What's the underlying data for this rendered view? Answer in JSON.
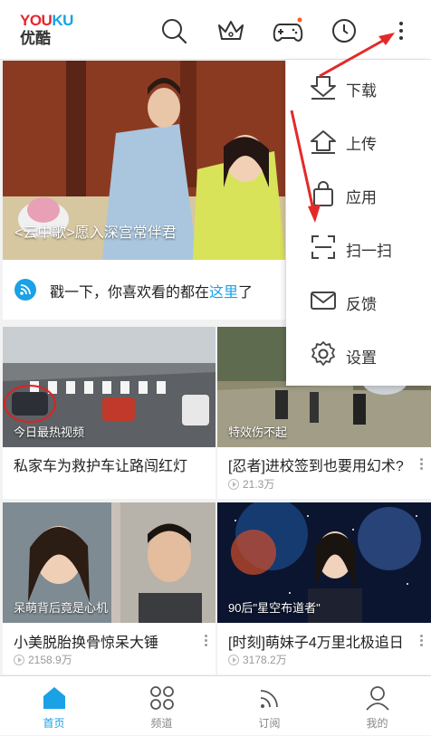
{
  "app": {
    "logo_en": "YOUKU",
    "logo_cn": "优酷",
    "brand_color": "#1aa1e6",
    "header_icons": [
      "search-icon",
      "crown-icon",
      "gamepad-icon",
      "history-icon",
      "more-icon"
    ]
  },
  "hero": {
    "caption": "<云中歌>愿入深宫常伴君"
  },
  "notice": {
    "text": "戳一下，你喜欢看的都在",
    "link": "这里",
    "tail": "了"
  },
  "menu": {
    "items": [
      {
        "label": "下载",
        "icon": "download-icon"
      },
      {
        "label": "上传",
        "icon": "upload-icon"
      },
      {
        "label": "应用",
        "icon": "bag-icon"
      },
      {
        "label": "扫一扫",
        "icon": "scan-icon"
      },
      {
        "label": "反馈",
        "icon": "mail-icon"
      },
      {
        "label": "设置",
        "icon": "settings-icon"
      }
    ]
  },
  "videos": [
    {
      "tag": "今日最热视频",
      "title": "私家车为救护车让路闯红灯",
      "views": ""
    },
    {
      "tag": "特效伤不起",
      "title": "[忍者]进校签到也要用幻术?",
      "views": "21.3万"
    },
    {
      "tag": "呆萌背后竟是心机",
      "title": "小美脱胎换骨惊呆大锤",
      "views": "2158.9万"
    },
    {
      "tag": "90后\"星空布道者\"",
      "title": "[时刻]萌妹子4万里北极追日",
      "views": "3178.2万"
    }
  ],
  "nav": {
    "tabs": [
      {
        "label": "首页",
        "icon": "home-icon",
        "active": true
      },
      {
        "label": "频道",
        "icon": "channels-icon",
        "active": false
      },
      {
        "label": "订阅",
        "icon": "subscribe-icon",
        "active": false
      },
      {
        "label": "我的",
        "icon": "profile-icon",
        "active": false
      }
    ]
  }
}
